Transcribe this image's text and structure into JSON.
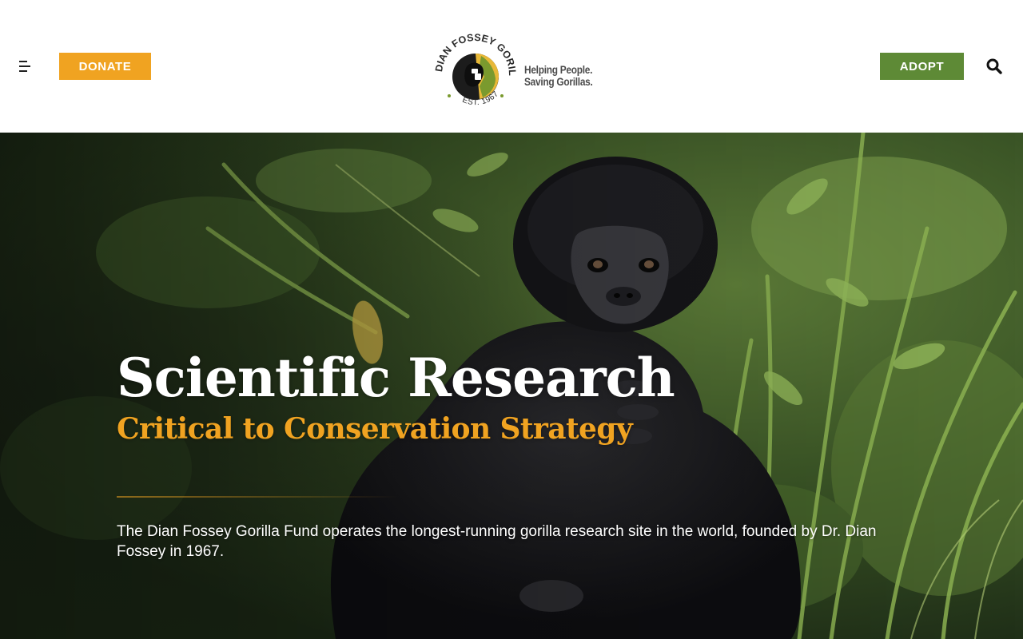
{
  "header": {
    "menu_icon": "hamburger-menu-icon",
    "donate_label": "DONATE",
    "adopt_label": "ADOPT",
    "search_icon": "search-icon",
    "logo": {
      "ring_text": "DIAN FOSSEY GORILLA FUND",
      "est_text": "EST. 1967"
    },
    "tagline_line1": "Helping People.",
    "tagline_line2": "Saving Gorillas."
  },
  "hero": {
    "title": "Scientific Research",
    "subtitle": "Critical to Conservation Strategy",
    "body": "The Dian Fossey Gorilla Fund operates the longest-running gorilla research site in the world, founded by Dr. Dian Fossey in 1967.",
    "image": "baby-gorilla-in-vegetation-photo"
  },
  "colors": {
    "donate": "#f0a321",
    "adopt": "#5e8a36",
    "subtitle": "#f0a321",
    "logo_green": "#7a9a2e",
    "logo_gold": "#e8b838"
  }
}
